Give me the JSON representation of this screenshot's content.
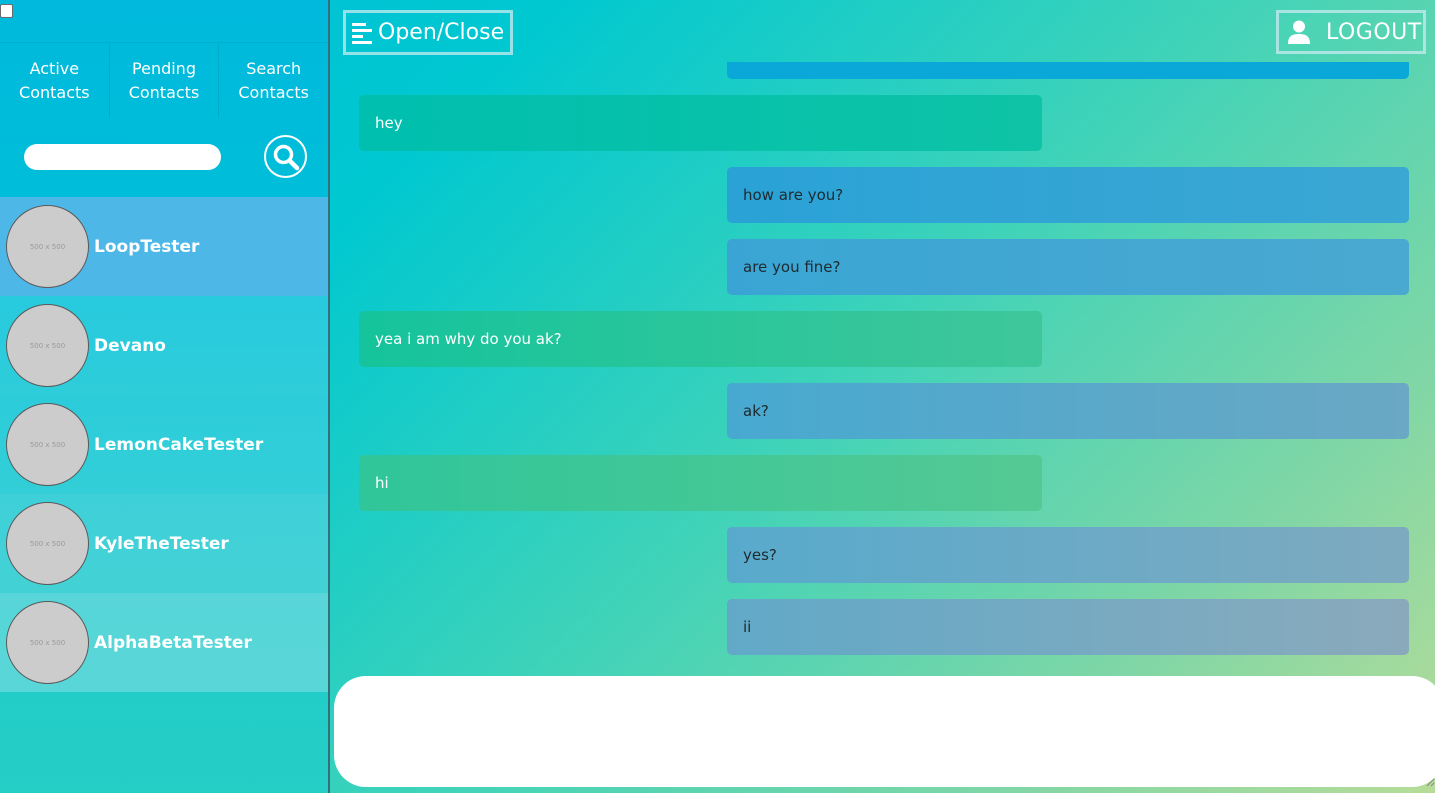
{
  "sidebar": {
    "tabs": [
      {
        "line1": "Active",
        "line2": "Contacts"
      },
      {
        "line1": "Pending",
        "line2": "Contacts"
      },
      {
        "line1": "Search",
        "line2": "Contacts"
      }
    ],
    "search": {
      "value": "",
      "placeholder": ""
    },
    "contacts": [
      {
        "name": "LoopTester",
        "avatar_text": "500 x 500",
        "active": true
      },
      {
        "name": "Devano",
        "avatar_text": "500 x 500",
        "active": false
      },
      {
        "name": "LemonCakeTester",
        "avatar_text": "500 x 500",
        "active": false
      },
      {
        "name": "KyleTheTester",
        "avatar_text": "500 x 500",
        "active": false
      },
      {
        "name": "AlphaBetaTester",
        "avatar_text": "500 x 500",
        "active": false
      }
    ]
  },
  "header": {
    "open_close_label": "Open/Close",
    "logout_label": "LOGOUT"
  },
  "messages": [
    {
      "side": "left",
      "text": "hey"
    },
    {
      "side": "right",
      "text": "how are you?"
    },
    {
      "side": "right",
      "text": "are you fine?"
    },
    {
      "side": "left",
      "text": "yea i am why do you ak?"
    },
    {
      "side": "right",
      "text": "ak?"
    },
    {
      "side": "left",
      "text": "hi"
    },
    {
      "side": "right",
      "text": "yes?"
    },
    {
      "side": "right",
      "text": "ii"
    }
  ],
  "composer": {
    "value": "",
    "placeholder": ""
  },
  "colors": {
    "sent_bubble": "#2aa3d4",
    "received_bubble": "#0fbfa6",
    "active_contact": "#4db8e8"
  }
}
